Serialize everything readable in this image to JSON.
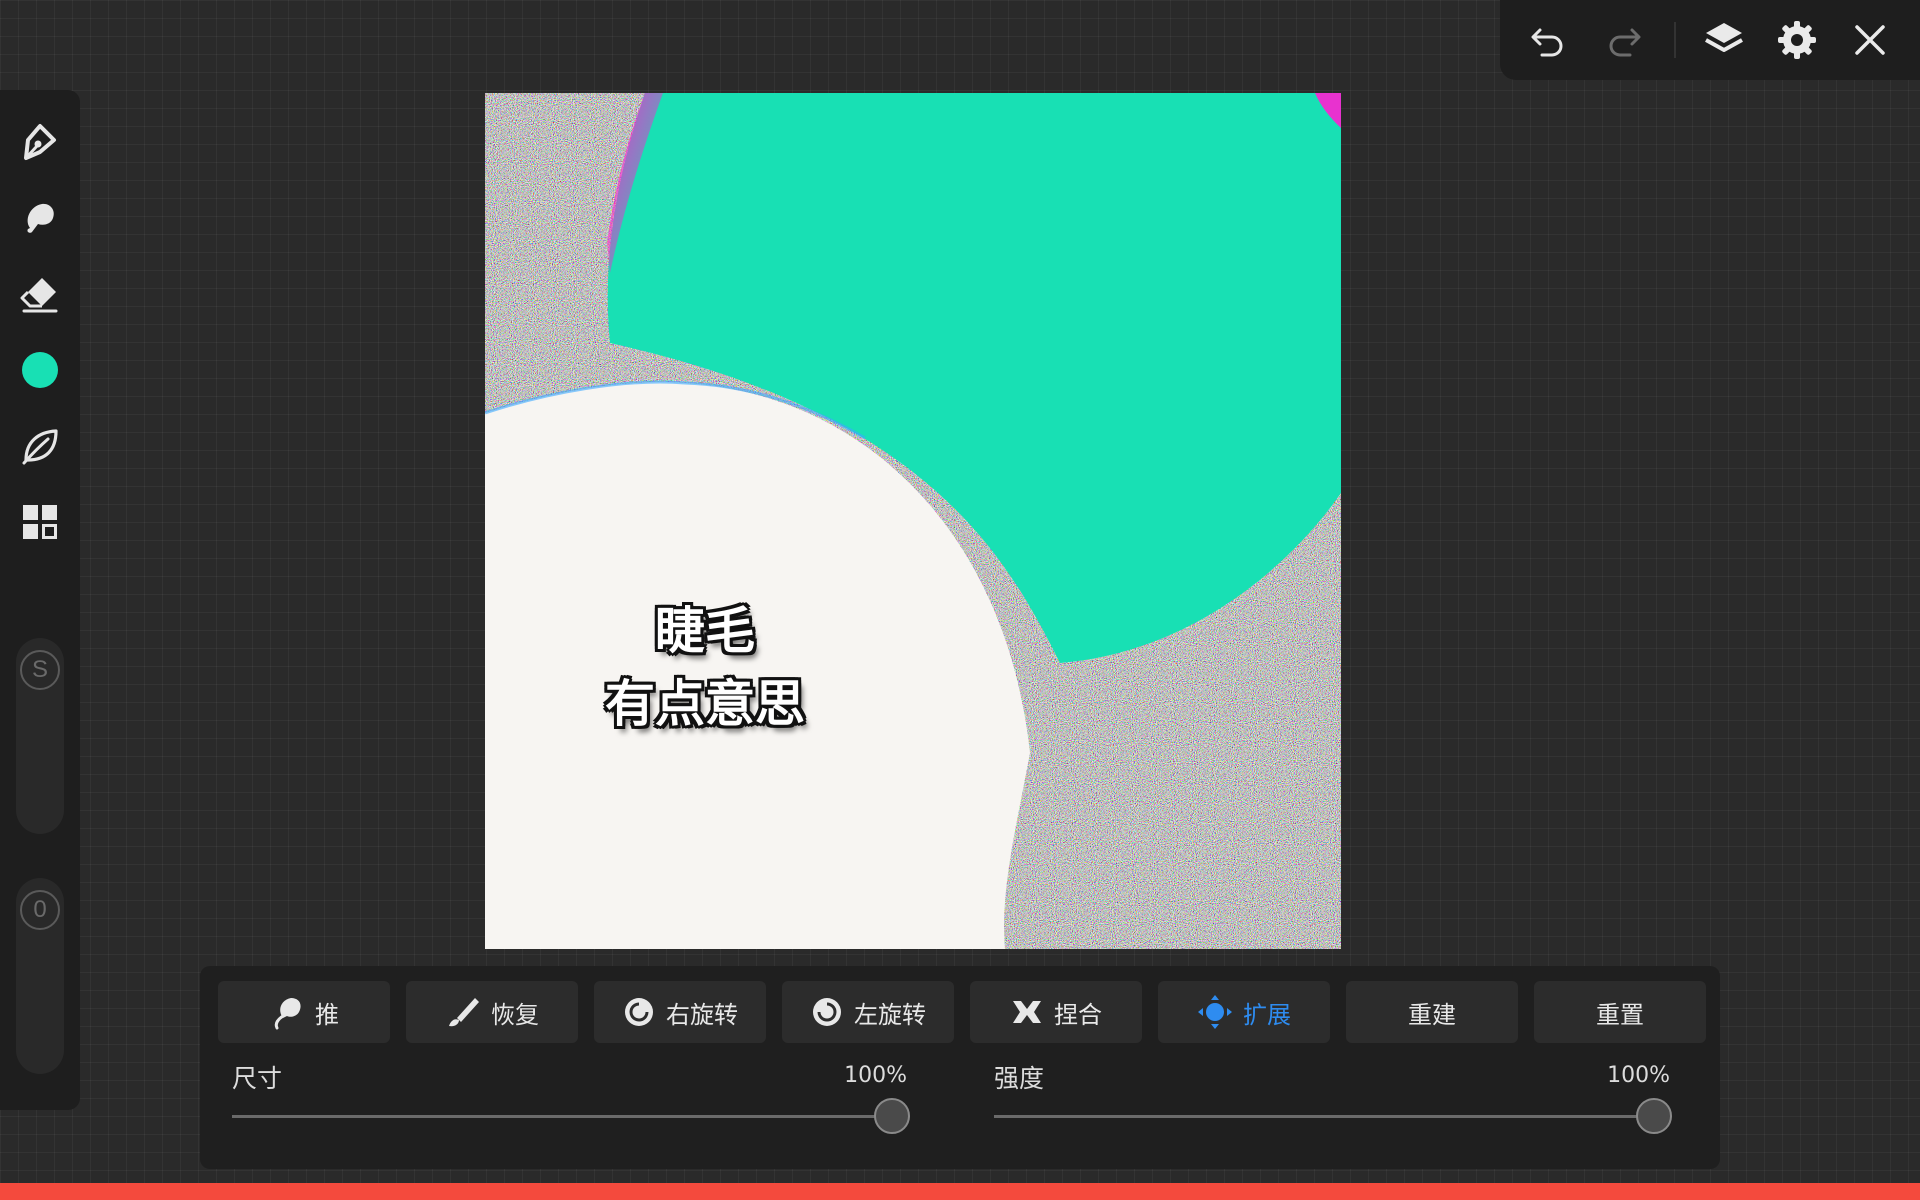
{
  "colors": {
    "accent": "#2e8cf0",
    "brush_color": "#18e0b4",
    "bottom_strip": "#f44a3d"
  },
  "topbar": {
    "icons": [
      "undo-icon",
      "redo-icon",
      "layers-icon",
      "settings-icon",
      "close-icon"
    ]
  },
  "sidebar": {
    "tools": [
      "pen-icon",
      "smudge-icon",
      "eraser-icon",
      "color-swatch",
      "liquify-leaf-icon",
      "grid-icon"
    ],
    "size_slider_label": "S",
    "opacity_slider_label": "0"
  },
  "canvas": {
    "caption_line1": "睫毛",
    "caption_line2": "有点意思"
  },
  "panel": {
    "modes": [
      {
        "label": "推",
        "icon": "push-icon",
        "active": false
      },
      {
        "label": "恢复",
        "icon": "restore-icon",
        "active": false
      },
      {
        "label": "右旋转",
        "icon": "twirl-right-icon",
        "active": false
      },
      {
        "label": "左旋转",
        "icon": "twirl-left-icon",
        "active": false
      },
      {
        "label": "捏合",
        "icon": "pinch-icon",
        "active": false
      },
      {
        "label": "扩展",
        "icon": "expand-icon",
        "active": true
      },
      {
        "label": "重建",
        "icon": "",
        "active": false
      },
      {
        "label": "重置",
        "icon": "",
        "active": false
      }
    ],
    "size": {
      "label": "尺寸",
      "value_text": "100%",
      "value": 1.0
    },
    "strength": {
      "label": "强度",
      "value_text": "100%",
      "value": 1.0
    }
  }
}
